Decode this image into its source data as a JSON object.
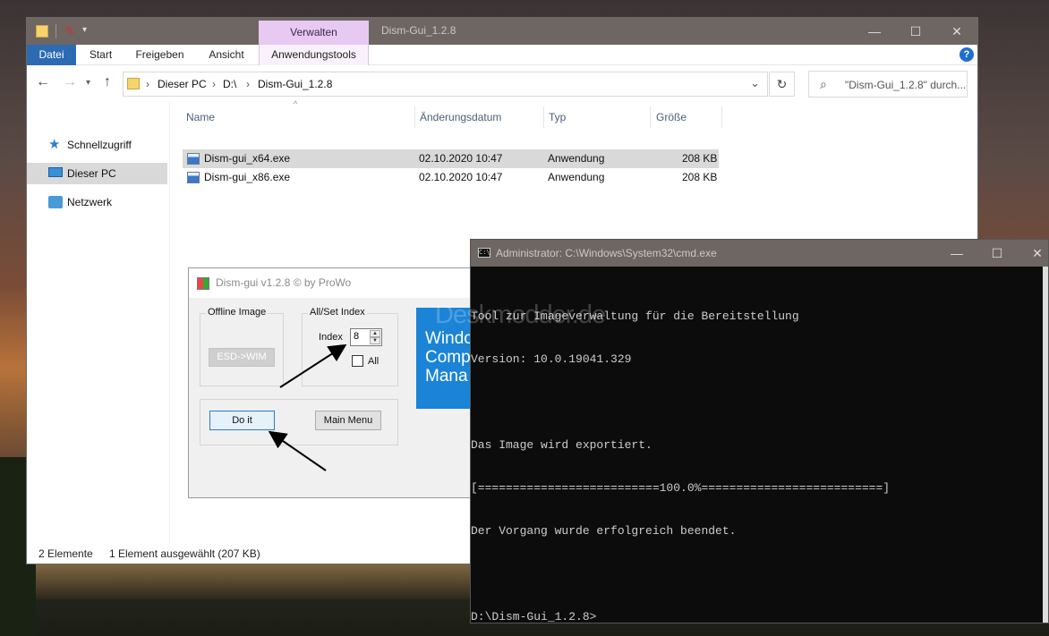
{
  "explorer": {
    "window_title": "Dism-Gui_1.2.8",
    "context_tab": "Verwalten",
    "ribbon_tabs": [
      "Datei",
      "Start",
      "Freigeben",
      "Ansicht",
      "Anwendungstools"
    ],
    "path": [
      "Dieser PC",
      "D:\\",
      "Dism-Gui_1.2.8"
    ],
    "search_placeholder": "\"Dism-Gui_1.2.8\" durch...",
    "nav_items": [
      "Schnellzugriff",
      "Dieser PC",
      "Netzwerk"
    ],
    "columns": [
      "Name",
      "Änderungsdatum",
      "Typ",
      "Größe"
    ],
    "files": [
      {
        "name": "Dism-gui_x64.exe",
        "date": "02.10.2020 10:47",
        "type": "Anwendung",
        "size": "208 KB"
      },
      {
        "name": "Dism-gui_x86.exe",
        "date": "02.10.2020 10:47",
        "type": "Anwendung",
        "size": "208 KB"
      }
    ],
    "status_count": "2 Elemente",
    "status_selection": "1 Element ausgewählt (207 KB)"
  },
  "dism": {
    "title": "Dism-gui v1.2.8     © by ProWo",
    "offline_group": "Offline Image",
    "esd_button": "ESD->WIM",
    "index_group": "All/Set Index",
    "index_label": "Index",
    "index_value": "8",
    "all_label": "All",
    "do_button": "Do it",
    "menu_button": "Main Menu",
    "banner_lines": [
      "Windo",
      "Comp",
      "Mana"
    ]
  },
  "cmd": {
    "title": "Administrator: C:\\Windows\\System32\\cmd.exe",
    "lines": [
      "Tool zur Imageverwaltung für die Bereitstellung",
      "Version: 10.0.19041.329",
      "",
      "Das Image wird exportiert.",
      "[==========================100.0%==========================]",
      "Der Vorgang wurde erfolgreich beendet.",
      "",
      "D:\\Dism-Gui_1.2.8>"
    ]
  },
  "watermark": "Deskmodder.de"
}
